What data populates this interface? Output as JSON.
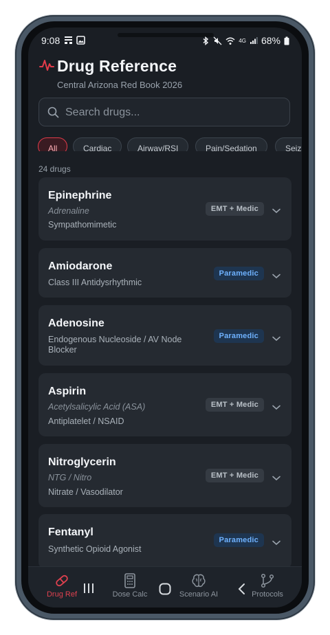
{
  "status_bar": {
    "time": "9:08",
    "battery": "68%",
    "network": "4G"
  },
  "header": {
    "title": "Drug Reference",
    "subtitle": "Central Arizona Red Book 2026",
    "accent_color": "#e23b4a"
  },
  "search": {
    "placeholder": "Search drugs...",
    "value": ""
  },
  "filters": [
    {
      "label": "All",
      "active": true
    },
    {
      "label": "Cardiac",
      "active": false
    },
    {
      "label": "Airway/RSI",
      "active": false
    },
    {
      "label": "Pain/Sedation",
      "active": false
    },
    {
      "label": "Seiz",
      "active": false
    }
  ],
  "drug_count": "24 drugs",
  "drugs": [
    {
      "name": "Epinephrine",
      "alias": "Adrenaline",
      "class": "Sympathomimetic",
      "badge": "EMT + Medic"
    },
    {
      "name": "Amiodarone",
      "alias": "",
      "class": "Class III Antidysrhythmic",
      "badge": "Paramedic"
    },
    {
      "name": "Adenosine",
      "alias": "",
      "class": "Endogenous Nucleoside / AV Node Blocker",
      "badge": "Paramedic"
    },
    {
      "name": "Aspirin",
      "alias": "Acetylsalicylic Acid (ASA)",
      "class": "Antiplatelet / NSAID",
      "badge": "EMT + Medic"
    },
    {
      "name": "Nitroglycerin",
      "alias": "NTG / Nitro",
      "class": "Nitrate / Vasodilator",
      "badge": "EMT + Medic"
    },
    {
      "name": "Fentanyl",
      "alias": "",
      "class": "Synthetic Opioid Agonist",
      "badge": "Paramedic"
    }
  ],
  "bottom_nav": [
    {
      "label": "Drug Ref",
      "icon": "pill-icon",
      "active": true
    },
    {
      "label": "Dose Calc",
      "icon": "calculator-icon",
      "active": false
    },
    {
      "label": "Scenario AI",
      "icon": "brain-icon",
      "active": false
    },
    {
      "label": "Protocols",
      "icon": "branch-icon",
      "active": false
    }
  ],
  "colors": {
    "background": "#1a1e24",
    "card": "#252a31",
    "emt_badge": "#353b43",
    "paramedic_badge": "#1e3550",
    "paramedic_text": "#6fb2ff"
  }
}
